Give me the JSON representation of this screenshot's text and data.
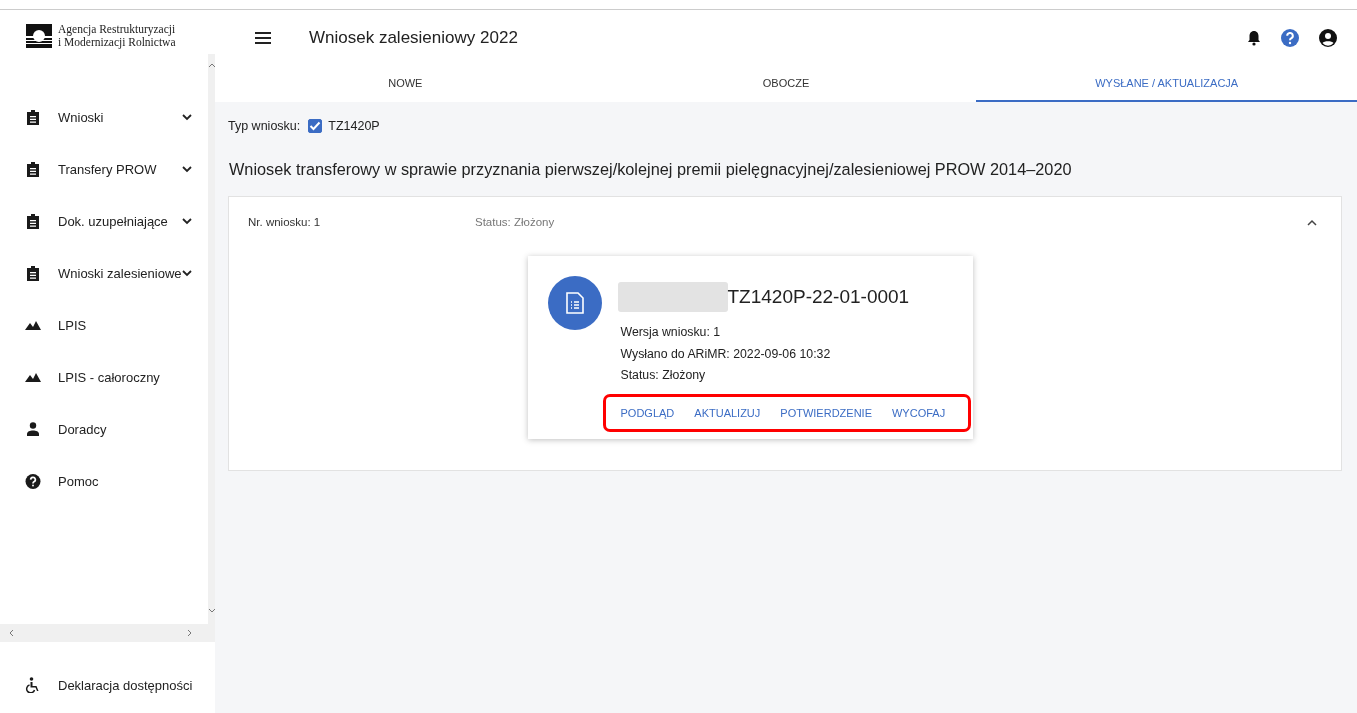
{
  "sidebar": {
    "logo_text": [
      "Agencja Restrukturyzacji",
      "i Modernizacji Rolnictwa"
    ],
    "items": [
      {
        "label": "Wnioski",
        "kind": "clipboard",
        "expandable": true
      },
      {
        "label": "Transfery PROW",
        "kind": "clipboard",
        "expandable": true
      },
      {
        "label": "Dok. uzupełniające",
        "kind": "clipboard",
        "expandable": true
      },
      {
        "label": "Wnioski zalesieniowe",
        "kind": "clipboard",
        "expandable": true
      },
      {
        "label": "LPIS",
        "kind": "mountains",
        "expandable": false
      },
      {
        "label": "LPIS - całoroczny",
        "kind": "mountains",
        "expandable": false
      },
      {
        "label": "Doradcy",
        "kind": "person",
        "expandable": false
      },
      {
        "label": "Pomoc",
        "kind": "help",
        "expandable": false
      }
    ],
    "footer_link": "Deklaracja dostępności"
  },
  "header": {
    "title": "Wniosek zalesieniowy 2022"
  },
  "tabs": [
    {
      "label": "NOWE",
      "selected": false
    },
    {
      "label": "OBOCZE",
      "selected": false
    },
    {
      "label": "WYSŁANE / AKTUALIZACJA",
      "selected": true
    }
  ],
  "type_filter": {
    "label": "Typ wniosku:",
    "value": "TZ1420P",
    "checked": true
  },
  "heading": "Wniosek transferowy w sprawie przyznania pierwszej/kolejnej premii pielęgnacyjnej/zalesieniowej PROW 2014–2020",
  "panel": {
    "number": "Nr. wniosku: 1",
    "status": "Status: Złożony",
    "expanded": true
  },
  "card": {
    "code": "TZ1420P-22-01-0001",
    "details": [
      "Wersja wniosku: 1",
      "Wysłano do ARiMR: 2022-09-06 10:32",
      "Status: Złożony"
    ],
    "actions": [
      "PODGLĄD",
      "AKTUALIZUJ",
      "POTWIERDZENIE",
      "WYCOFAJ"
    ]
  }
}
